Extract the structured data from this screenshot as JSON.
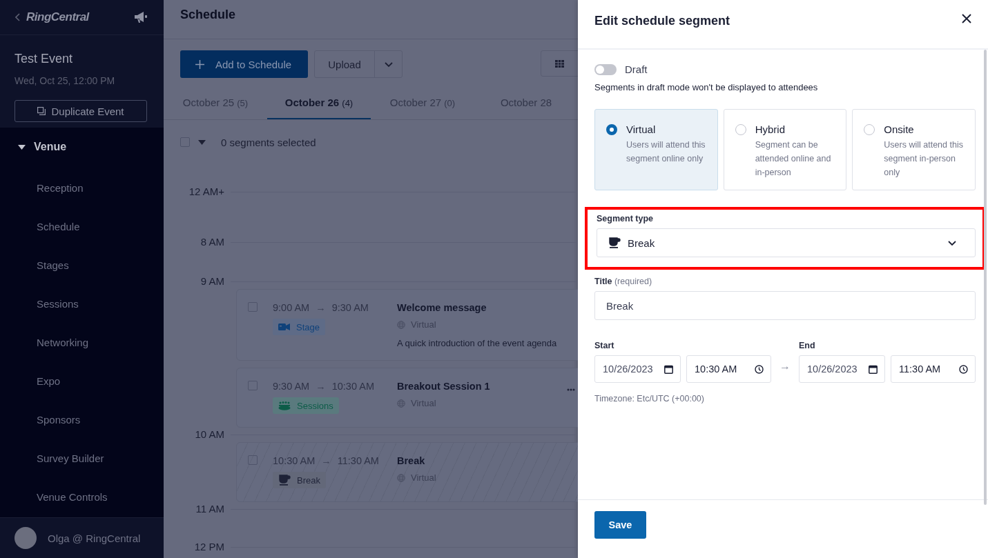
{
  "sidebar": {
    "logo": "RingCentral",
    "event_title": "Test Event",
    "event_date": "Wed, Oct 25, 12:00 PM",
    "duplicate_button": "Duplicate Event",
    "section": {
      "label": "Venue",
      "expanded": true,
      "items": [
        {
          "label": "Reception"
        },
        {
          "label": "Schedule"
        },
        {
          "label": "Stages"
        },
        {
          "label": "Sessions"
        },
        {
          "label": "Networking"
        },
        {
          "label": "Expo"
        },
        {
          "label": "Sponsors"
        },
        {
          "label": "Survey Builder"
        },
        {
          "label": "Venue Controls"
        }
      ]
    },
    "user": "Olga @ RingCentral"
  },
  "main": {
    "title": "Schedule",
    "add_button": "Add to Schedule",
    "upload_button": "Upload",
    "tabs": [
      {
        "label": "October 25",
        "count": "(5)",
        "selected": false
      },
      {
        "label": "October 26",
        "count": "(4)",
        "selected": true
      },
      {
        "label": "October 27",
        "count": "(0)",
        "selected": false
      },
      {
        "label": "October 28",
        "selected": false
      }
    ],
    "selection": {
      "checked": false,
      "label": "0 segments selected"
    },
    "timeline": [
      {
        "kind": "hour",
        "label": "12 AM+"
      },
      {
        "kind": "hour",
        "label": "8 AM"
      },
      {
        "kind": "hour",
        "label": "9 AM"
      },
      {
        "kind": "stage",
        "checked": false,
        "start": "9:00 AM",
        "arrow": "→",
        "end": "9:30 AM",
        "type_label": "Stage",
        "title": "Welcome message",
        "mode": "Virtual",
        "description": "A quick introduction of the event agenda",
        "menu_visible": false
      },
      {
        "kind": "sessions",
        "checked": false,
        "start": "9:30 AM",
        "arrow": "→",
        "end": "10:30 AM",
        "type_label": "Sessions",
        "title": "Breakout Session 1",
        "mode": "Virtual",
        "menu_visible": true
      },
      {
        "kind": "hour",
        "label": "10 AM"
      },
      {
        "kind": "break",
        "checked": false,
        "start": "10:30 AM",
        "arrow": "→",
        "end": "11:30 AM",
        "type_label": "Break",
        "title": "Break",
        "mode": "Virtual",
        "menu_visible": false
      },
      {
        "kind": "hour",
        "label": "11 AM"
      },
      {
        "kind": "hour",
        "label": "12 PM"
      }
    ]
  },
  "panel": {
    "title": "Edit schedule segment",
    "draft": {
      "label": "Draft",
      "on": false
    },
    "draft_note": "Segments in draft mode won't be displayed to attendees",
    "attendance": [
      {
        "label": "Virtual",
        "description": "Users will attend this segment online only",
        "selected": true
      },
      {
        "label": "Hybrid",
        "description": "Segment can be attended online and in-person",
        "selected": false
      },
      {
        "label": "Onsite",
        "description": "Users will attend this segment in-person only",
        "selected": false
      }
    ],
    "segment_type": {
      "label": "Segment type",
      "value": "Break",
      "highlighted": true
    },
    "title_field": {
      "label": "Title",
      "hint": "(required)",
      "value": "Break"
    },
    "start": {
      "label": "Start",
      "date": "10/26/2023",
      "time": "10:30 AM"
    },
    "arrow": "→",
    "end": {
      "label": "End",
      "date": "10/26/2023",
      "time": "11:30 AM"
    },
    "timezone": "Timezone: Etc/UTC (+00:00)",
    "save_button": "Save"
  }
}
